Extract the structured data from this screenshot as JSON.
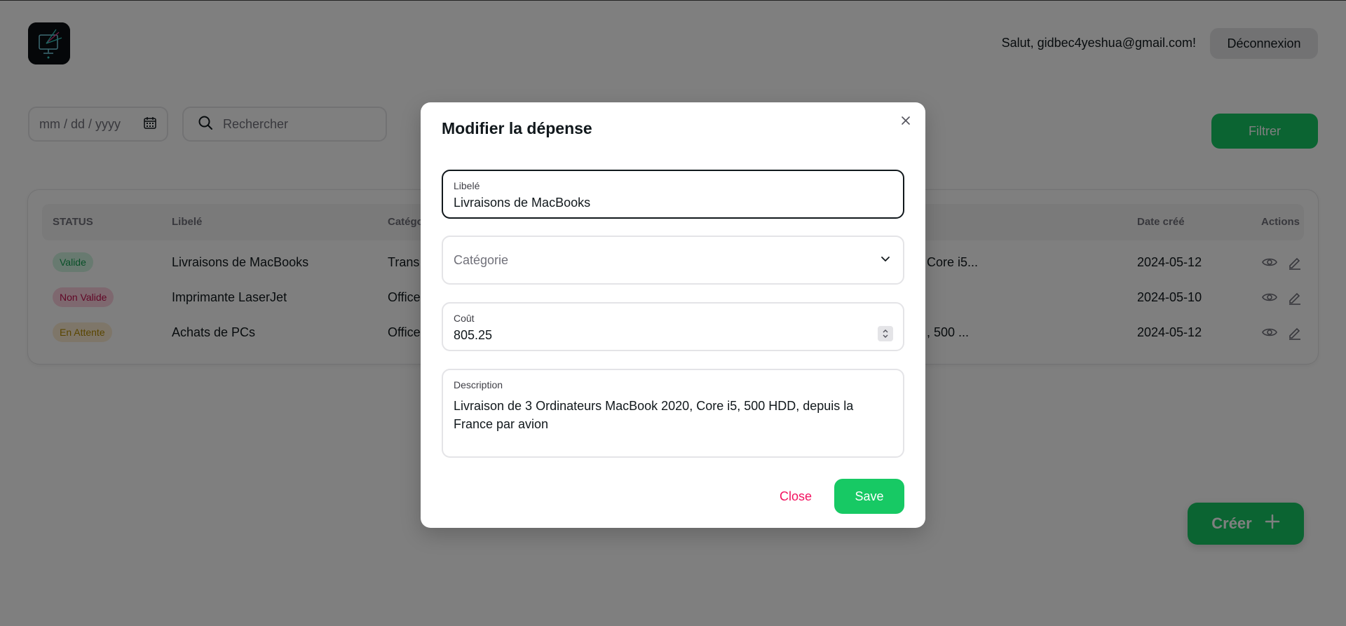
{
  "header": {
    "greeting": "Salut, gidbec4yeshua@gmail.com!",
    "logout_label": "Déconnexion"
  },
  "filters": {
    "date_placeholder": "mm / dd / yyyy",
    "search_placeholder": "Rechercher",
    "filter_label": "Filtrer"
  },
  "table": {
    "columns": [
      "STATUS",
      "Libelé",
      "Catégo",
      "Date créé",
      "Actions"
    ],
    "rows": [
      {
        "status": "Valide",
        "label": "Livraisons de MacBooks",
        "category": "Trans",
        "description": "Core i5...",
        "date": "2024-05-12"
      },
      {
        "status": "Non Valide",
        "label": "Imprimante LaserJet",
        "category": "Office",
        "description": "",
        "date": "2024-05-10"
      },
      {
        "status": "En Attente",
        "label": "Achats de PCs",
        "category": "Office",
        "description": ", 500 ...",
        "date": "2024-05-12"
      }
    ]
  },
  "create_label": "Créer",
  "modal": {
    "title": "Modifier la dépense",
    "label_field": {
      "label": "Libelé",
      "value": "Livraisons de MacBooks"
    },
    "category_field": {
      "placeholder": "Catégorie"
    },
    "cost_field": {
      "label": "Coût",
      "value": "805.25"
    },
    "description_field": {
      "label": "Description",
      "value": "Livraison de 3 Ordinateurs MacBook 2020, Core i5, 500 HDD, depuis la France par avion"
    },
    "close_label": "Close",
    "save_label": "Save"
  },
  "colors": {
    "success": "#17c964",
    "danger": "#f31260",
    "backdrop": "rgba(0,0,0,0.5)"
  },
  "icons": [
    "app-logo",
    "calendar-icon",
    "search-icon",
    "eye-icon",
    "edit-icon",
    "plus-icon",
    "close-icon",
    "chevron-down-icon",
    "spinner-arrows-icon"
  ]
}
